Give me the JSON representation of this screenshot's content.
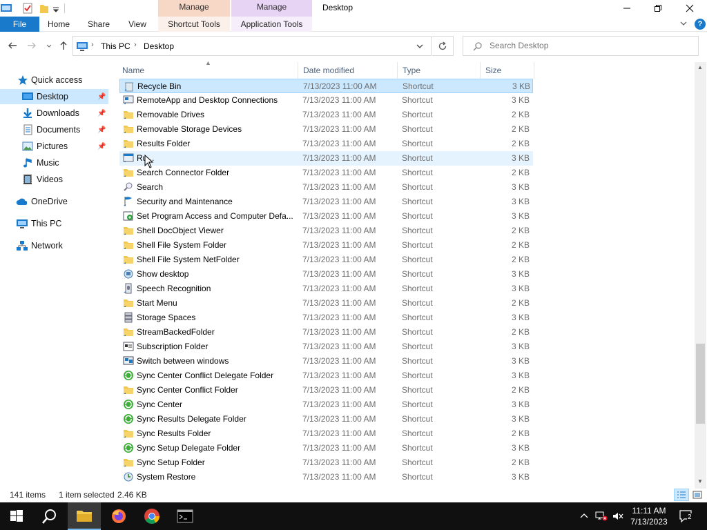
{
  "window": {
    "title": "Desktop",
    "ctx_shortcut_group": "Manage",
    "ctx_app_group": "Manage"
  },
  "ribbon": {
    "tabs": [
      "File",
      "Home",
      "Share",
      "View",
      "Shortcut Tools",
      "Application Tools"
    ],
    "help": "?"
  },
  "address": {
    "crumbs": [
      "This PC",
      "Desktop"
    ]
  },
  "search": {
    "placeholder": "Search Desktop"
  },
  "navpane": {
    "items": [
      {
        "label": "Quick access",
        "icon": "star-icon"
      },
      {
        "label": "Desktop",
        "icon": "desktop-icon",
        "pinned": true
      },
      {
        "label": "Downloads",
        "icon": "download-icon",
        "pinned": true
      },
      {
        "label": "Documents",
        "icon": "document-icon",
        "pinned": true
      },
      {
        "label": "Pictures",
        "icon": "picture-icon",
        "pinned": true
      },
      {
        "label": "Music",
        "icon": "music-icon"
      },
      {
        "label": "Videos",
        "icon": "video-icon"
      },
      {
        "label": "OneDrive",
        "icon": "cloud-icon"
      },
      {
        "label": "This PC",
        "icon": "computer-icon"
      },
      {
        "label": "Network",
        "icon": "network-icon"
      }
    ]
  },
  "columns": {
    "name": "Name",
    "date": "Date modified",
    "type": "Type",
    "size": "Size"
  },
  "files": [
    {
      "name": "Recycle Bin",
      "date": "7/13/2023 11:00 AM",
      "type": "Shortcut",
      "size": "3 KB",
      "icon": "recycle-bin-icon"
    },
    {
      "name": "RemoteApp and Desktop Connections",
      "date": "7/13/2023 11:00 AM",
      "type": "Shortcut",
      "size": "3 KB",
      "icon": "remote-app-icon"
    },
    {
      "name": "Removable Drives",
      "date": "7/13/2023 11:00 AM",
      "type": "Shortcut",
      "size": "2 KB",
      "icon": "folder-icon"
    },
    {
      "name": "Removable Storage Devices",
      "date": "7/13/2023 11:00 AM",
      "type": "Shortcut",
      "size": "2 KB",
      "icon": "folder-icon"
    },
    {
      "name": "Results Folder",
      "date": "7/13/2023 11:00 AM",
      "type": "Shortcut",
      "size": "2 KB",
      "icon": "folder-icon"
    },
    {
      "name": "Ru...",
      "date": "7/13/2023 11:00 AM",
      "type": "Shortcut",
      "size": "3 KB",
      "icon": "run-icon"
    },
    {
      "name": "Search Connector Folder",
      "date": "7/13/2023 11:00 AM",
      "type": "Shortcut",
      "size": "2 KB",
      "icon": "folder-icon"
    },
    {
      "name": "Search",
      "date": "7/13/2023 11:00 AM",
      "type": "Shortcut",
      "size": "3 KB",
      "icon": "search-icon"
    },
    {
      "name": "Security and Maintenance",
      "date": "7/13/2023 11:00 AM",
      "type": "Shortcut",
      "size": "3 KB",
      "icon": "flag-icon"
    },
    {
      "name": "Set Program Access and Computer Defa...",
      "date": "7/13/2023 11:00 AM",
      "type": "Shortcut",
      "size": "3 KB",
      "icon": "program-access-icon"
    },
    {
      "name": "Shell DocObject Viewer",
      "date": "7/13/2023 11:00 AM",
      "type": "Shortcut",
      "size": "2 KB",
      "icon": "folder-icon"
    },
    {
      "name": "Shell File System Folder",
      "date": "7/13/2023 11:00 AM",
      "type": "Shortcut",
      "size": "2 KB",
      "icon": "folder-icon"
    },
    {
      "name": "Shell File System NetFolder",
      "date": "7/13/2023 11:00 AM",
      "type": "Shortcut",
      "size": "2 KB",
      "icon": "folder-icon"
    },
    {
      "name": "Show desktop",
      "date": "7/13/2023 11:00 AM",
      "type": "Shortcut",
      "size": "3 KB",
      "icon": "show-desktop-icon"
    },
    {
      "name": "Speech Recognition",
      "date": "7/13/2023 11:00 AM",
      "type": "Shortcut",
      "size": "3 KB",
      "icon": "microphone-icon"
    },
    {
      "name": "Start Menu",
      "date": "7/13/2023 11:00 AM",
      "type": "Shortcut",
      "size": "2 KB",
      "icon": "folder-icon"
    },
    {
      "name": "Storage Spaces",
      "date": "7/13/2023 11:00 AM",
      "type": "Shortcut",
      "size": "3 KB",
      "icon": "storage-icon"
    },
    {
      "name": "StreamBackedFolder",
      "date": "7/13/2023 11:00 AM",
      "type": "Shortcut",
      "size": "2 KB",
      "icon": "folder-icon"
    },
    {
      "name": "Subscription Folder",
      "date": "7/13/2023 11:00 AM",
      "type": "Shortcut",
      "size": "3 KB",
      "icon": "subscription-icon"
    },
    {
      "name": "Switch between windows",
      "date": "7/13/2023 11:00 AM",
      "type": "Shortcut",
      "size": "3 KB",
      "icon": "switch-windows-icon"
    },
    {
      "name": "Sync Center Conflict Delegate Folder",
      "date": "7/13/2023 11:00 AM",
      "type": "Shortcut",
      "size": "3 KB",
      "icon": "sync-icon"
    },
    {
      "name": "Sync Center Conflict Folder",
      "date": "7/13/2023 11:00 AM",
      "type": "Shortcut",
      "size": "2 KB",
      "icon": "folder-icon"
    },
    {
      "name": "Sync Center",
      "date": "7/13/2023 11:00 AM",
      "type": "Shortcut",
      "size": "3 KB",
      "icon": "sync-icon"
    },
    {
      "name": "Sync Results Delegate Folder",
      "date": "7/13/2023 11:00 AM",
      "type": "Shortcut",
      "size": "3 KB",
      "icon": "sync-icon"
    },
    {
      "name": "Sync Results Folder",
      "date": "7/13/2023 11:00 AM",
      "type": "Shortcut",
      "size": "2 KB",
      "icon": "folder-icon"
    },
    {
      "name": "Sync Setup Delegate Folder",
      "date": "7/13/2023 11:00 AM",
      "type": "Shortcut",
      "size": "3 KB",
      "icon": "sync-icon"
    },
    {
      "name": "Sync Setup Folder",
      "date": "7/13/2023 11:00 AM",
      "type": "Shortcut",
      "size": "2 KB",
      "icon": "folder-icon"
    },
    {
      "name": "System Restore",
      "date": "7/13/2023 11:00 AM",
      "type": "Shortcut",
      "size": "3 KB",
      "icon": "system-restore-icon"
    }
  ],
  "status": {
    "count": "141 items",
    "selected": "1 item selected",
    "selected_size": "2.46 KB"
  },
  "taskbar": {
    "time": "11:11 AM",
    "date": "7/13/2023",
    "notifications": "2"
  },
  "colors": {
    "accent": "#1979ca",
    "selection": "#cce8ff",
    "folder": "#f2c94c"
  }
}
